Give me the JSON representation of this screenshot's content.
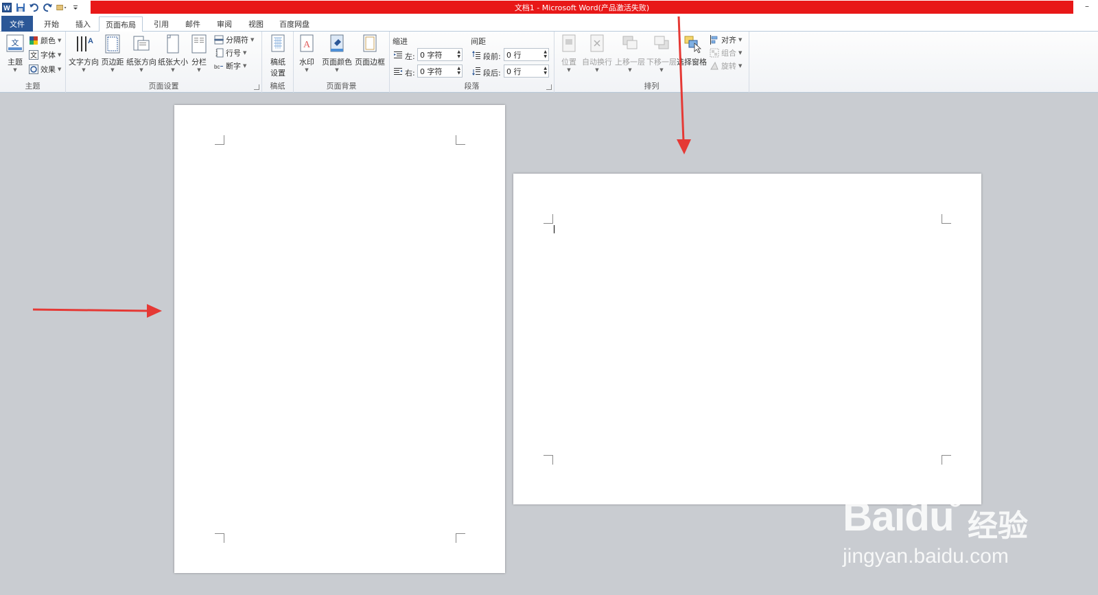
{
  "window": {
    "title": "文档1 - Microsoft Word(产品激活失败)",
    "minimize": "–"
  },
  "tabs": [
    {
      "label": "文件"
    },
    {
      "label": "开始"
    },
    {
      "label": "插入"
    },
    {
      "label": "页面布局"
    },
    {
      "label": "引用"
    },
    {
      "label": "邮件"
    },
    {
      "label": "审阅"
    },
    {
      "label": "视图"
    },
    {
      "label": "百度网盘"
    }
  ],
  "active_tab": "页面布局",
  "ribbon": {
    "theme": {
      "group_label": "主题",
      "themes_label": "主题",
      "colors_label": "颜色",
      "fonts_label": "字体",
      "effects_label": "效果"
    },
    "page_setup": {
      "group_label": "页面设置",
      "text_direction": "文字方向",
      "margins": "页边距",
      "orientation": "纸张方向",
      "size": "纸张大小",
      "columns": "分栏",
      "breaks": "分隔符",
      "line_numbers": "行号",
      "hyphenation": "断字"
    },
    "manuscript": {
      "group_label": "稿纸",
      "settings_line1": "稿纸",
      "settings_line2": "设置"
    },
    "page_background": {
      "group_label": "页面背景",
      "watermark": "水印",
      "page_color": "页面颜色",
      "page_borders": "页面边框"
    },
    "paragraph": {
      "group_label": "段落",
      "indent_label": "缩进",
      "indent_left_label": "左:",
      "indent_left_value": "0 字符",
      "indent_right_label": "右:",
      "indent_right_value": "0 字符",
      "spacing_label": "间距",
      "spacing_before_label": "段前:",
      "spacing_before_value": "0 行",
      "spacing_after_label": "段后:",
      "spacing_after_value": "0 行"
    },
    "arrange": {
      "group_label": "排列",
      "position": "位置",
      "wrap_text": "自动换行",
      "bring_forward": "上移一层",
      "send_backward": "下移一层",
      "selection_pane": "选择窗格",
      "align": "对齐",
      "group": "组合",
      "rotate": "旋转"
    }
  },
  "watermark": {
    "brand": "Baidu",
    "suffix": "经验",
    "url": "jingyan.baidu.com"
  },
  "colors": {
    "title_bar": "#e81818",
    "file_tab": "#2b5797",
    "annotation_arrow": "#e53935"
  }
}
